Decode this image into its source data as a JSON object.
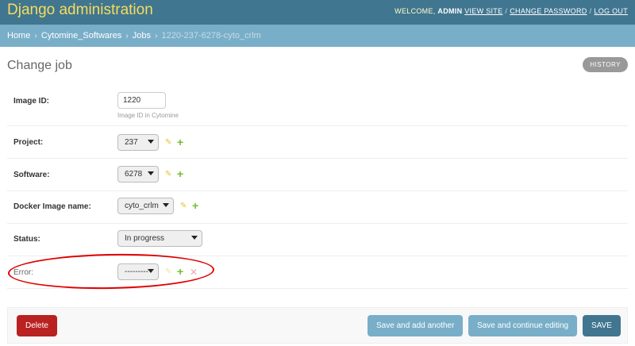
{
  "header": {
    "brand": "Django administration",
    "welcome": "WELCOME,",
    "user": "ADMIN",
    "links": [
      "VIEW SITE",
      "CHANGE PASSWORD",
      "LOG OUT"
    ]
  },
  "breadcrumbs": [
    "Home",
    "Cytomine_Softwares",
    "Jobs",
    "1220-237-6278-cyto_crlm"
  ],
  "title": "Change job",
  "history_label": "HISTORY",
  "fields": {
    "image_id": {
      "label": "Image ID:",
      "value": "1220",
      "help": "Image ID in Cytomine"
    },
    "project": {
      "label": "Project:",
      "value": "237"
    },
    "software": {
      "label": "Software:",
      "value": "6278"
    },
    "docker_image": {
      "label": "Docker Image name:",
      "value": "cyto_crlm"
    },
    "status": {
      "label": "Status:",
      "value": "In progress"
    },
    "error": {
      "label": "Error:",
      "value": "---------"
    }
  },
  "actions": {
    "delete": "Delete",
    "save_add": "Save and add another",
    "save_continue": "Save and continue editing",
    "save": "SAVE"
  },
  "colors": {
    "header_bg": "#417690",
    "brand": "#f5dd5d",
    "breadcrumb_bg": "#79aec8",
    "delete": "#ba2121",
    "annotation": "#e00000"
  },
  "icons": {
    "edit": "pencil-icon",
    "add": "plus-icon",
    "remove": "x-icon",
    "select": "chevron-down-icon"
  }
}
